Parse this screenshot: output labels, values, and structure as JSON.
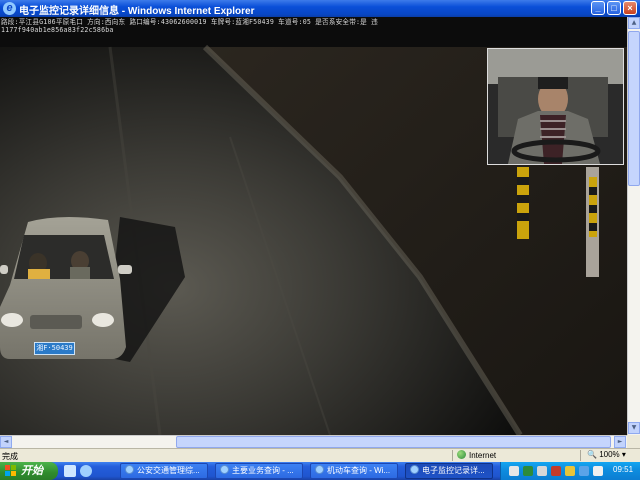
{
  "window": {
    "title": "电子监控记录详细信息 - Windows Internet Explorer",
    "controls": {
      "minimize": "_",
      "maximize": "□",
      "close": "×"
    }
  },
  "capture": {
    "overlay_line1": "路段:平江县G106平原毛口 方向:西向东 路口编号:43062600019 车牌号:蓝湘F50439 车道号:05 是否系安全带:是 违",
    "overlay_line2": "1177f940ab1e856a83f22c586ba",
    "plate_text": "湘F·50439"
  },
  "statusbar": {
    "status_text": "完成",
    "zone_text": "Internet",
    "zoom_text": "100%"
  },
  "taskbar": {
    "start_label": "开始",
    "items": [
      {
        "label": "公安交通管理综..."
      },
      {
        "label": "主要业务查询 - ..."
      },
      {
        "label": "机动车查询 - Wi..."
      },
      {
        "label": "电子监控记录详..."
      }
    ],
    "clock": "09:51"
  },
  "colors": {
    "titlebar": "#0a4fd8",
    "taskbar": "#245edb",
    "start_button": "#2f8b2d",
    "plate": "#2a7ac8"
  },
  "icons": [
    "ie-icon",
    "minimize-icon",
    "maximize-icon",
    "close-icon",
    "globe-icon",
    "windows-flag-icon",
    "tray-icons"
  ]
}
